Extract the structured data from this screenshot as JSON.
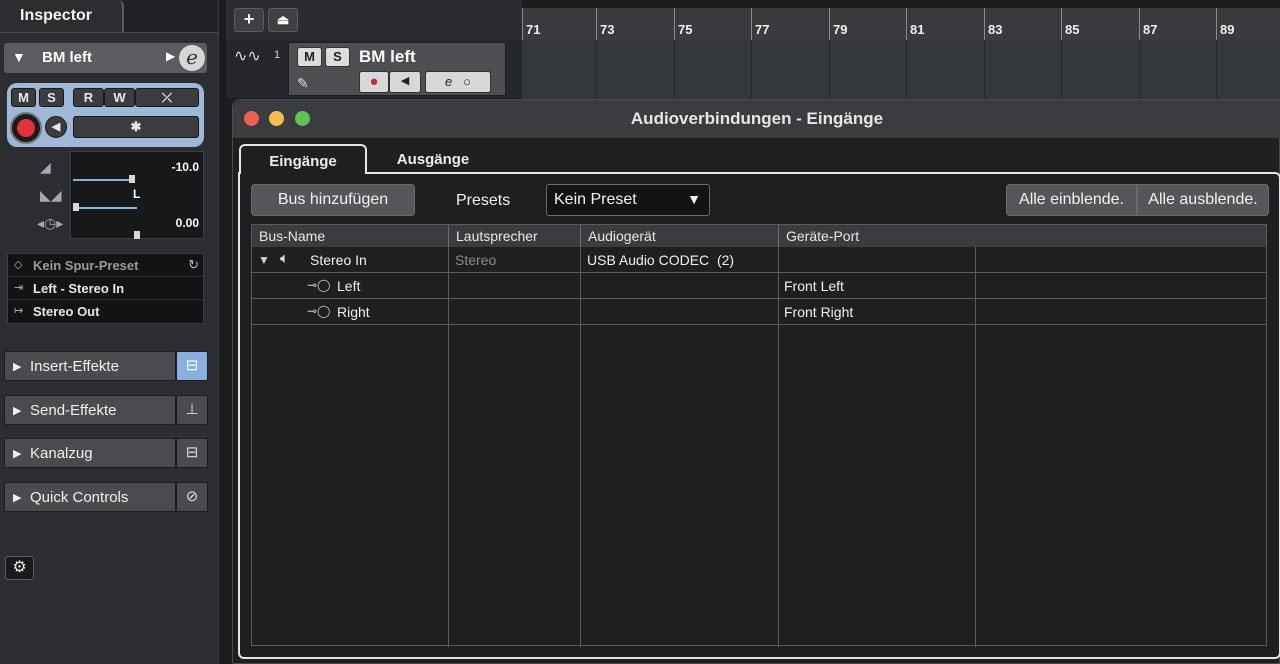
{
  "inspector": {
    "title": "Inspector",
    "track_name": "BM left",
    "buttons": {
      "m": "M",
      "s": "S",
      "r": "R",
      "w": "W"
    },
    "volume_value": "-10.0",
    "pan_value": "L",
    "delay_value": "0.00",
    "presets": [
      {
        "icon": "track-preset-icon",
        "label": "Kein Spur-Preset"
      },
      {
        "icon": "input-icon",
        "label": "Left - Stereo In"
      },
      {
        "icon": "output-icon",
        "label": "Stereo Out"
      }
    ],
    "sections": [
      {
        "label": "Insert-Effekte",
        "icon": "insert-bypass-icon"
      },
      {
        "label": "Send-Effekte",
        "icon": "send-icon"
      },
      {
        "label": "Kanalzug",
        "icon": "channel-strip-icon"
      },
      {
        "label": "Quick Controls",
        "icon": "quick-controls-icon"
      }
    ]
  },
  "project": {
    "ruler_marks": [
      "71",
      "73",
      "75",
      "77",
      "79",
      "81",
      "83",
      "85",
      "87",
      "89"
    ],
    "track": {
      "number": "1",
      "name": "BM left",
      "m": "M",
      "s": "S",
      "edit": "e"
    }
  },
  "dialog": {
    "title": "Audioverbindungen - Eingänge",
    "tabs": [
      "Eingänge",
      "Ausgänge"
    ],
    "add_bus_label": "Bus hinzufügen",
    "presets_label": "Presets",
    "preset_value": "Kein Preset",
    "show_all_label": "Alle einblende.",
    "hide_all_label": "Alle ausblende.",
    "columns": [
      "Bus-Name",
      "Lautsprecher",
      "Audiogerät",
      "Geräte-Port"
    ],
    "rows": [
      {
        "name": "Stereo In",
        "speaker": "Stereo",
        "device": "USB Audio CODEC  (2)",
        "port": ""
      },
      {
        "name": "Left",
        "speaker": "",
        "device": "",
        "port": "Front Left"
      },
      {
        "name": "Right",
        "speaker": "",
        "device": "",
        "port": "Front Right"
      }
    ]
  },
  "colors": {
    "record": "#e0343a",
    "accent_blue": "#9fb8d8",
    "close": "#ee5e55",
    "minimize": "#f4bd4f",
    "zoom": "#5fc454"
  }
}
